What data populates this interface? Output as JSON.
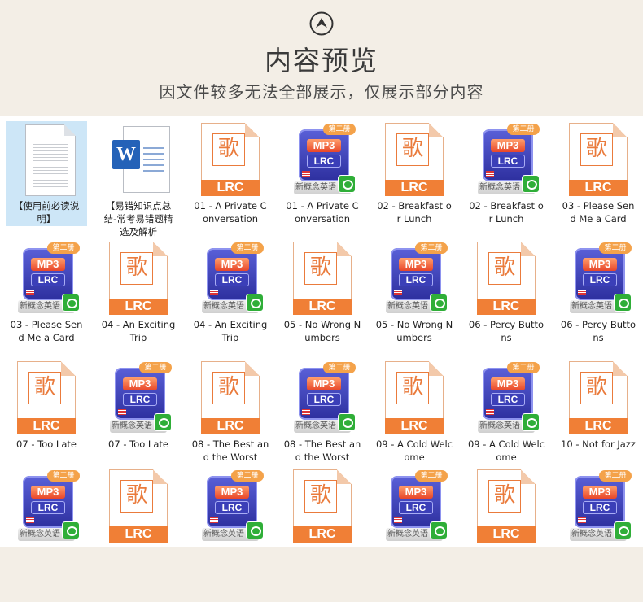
{
  "header": {
    "title": "内容预览",
    "subtitle": "因文件较多无法全部展示，仅展示部分内容"
  },
  "files": [
    {
      "type": "txt",
      "label": "【使用前必读说明】",
      "selected": true
    },
    {
      "type": "doc",
      "label": "【易错知识点总结-常考易错题精选及解析"
    },
    {
      "type": "lrc",
      "label": "01 - A Private Conversation"
    },
    {
      "type": "mp3",
      "label": "01 - A Private Conversation"
    },
    {
      "type": "lrc",
      "label": "02 - Breakfast or Lunch"
    },
    {
      "type": "mp3",
      "label": "02 - Breakfast or Lunch"
    },
    {
      "type": "lrc",
      "label": "03 - Please Send Me a Card"
    },
    {
      "type": "mp3",
      "label": "03 - Please Send Me a Card"
    },
    {
      "type": "lrc",
      "label": "04 - An Exciting Trip"
    },
    {
      "type": "mp3",
      "label": "04 - An Exciting Trip"
    },
    {
      "type": "lrc",
      "label": "05 - No Wrong Numbers"
    },
    {
      "type": "mp3",
      "label": "05 - No Wrong Numbers"
    },
    {
      "type": "lrc",
      "label": "06 - Percy Buttons"
    },
    {
      "type": "mp3",
      "label": "06 - Percy Buttons"
    },
    {
      "type": "lrc",
      "label": "07 - Too Late"
    },
    {
      "type": "mp3",
      "label": "07 - Too Late"
    },
    {
      "type": "lrc",
      "label": "08 - The Best and the Worst"
    },
    {
      "type": "mp3",
      "label": "08 - The Best and the Worst"
    },
    {
      "type": "lrc",
      "label": "09 - A Cold Welcome"
    },
    {
      "type": "mp3",
      "label": "09 - A Cold Welcome"
    },
    {
      "type": "lrc",
      "label": "10 - Not for Jazz"
    },
    {
      "type": "mp3",
      "label": ""
    },
    {
      "type": "lrc",
      "label": ""
    },
    {
      "type": "mp3",
      "label": ""
    },
    {
      "type": "lrc",
      "label": ""
    },
    {
      "type": "mp3",
      "label": ""
    },
    {
      "type": "lrc",
      "label": ""
    },
    {
      "type": "mp3",
      "label": ""
    }
  ],
  "icons": {
    "lrc_glyph": "歌",
    "lrc_text": "LRC",
    "mp3_tag": "第二册",
    "mp3_text": "MP3",
    "mp3_sub": "LRC",
    "mp3_strip": "新概念英语",
    "doc_letter": "W"
  },
  "colors": {
    "accent": "#f07f36",
    "mp3_blue": "#3b3fb8",
    "selection": "#cde6f7"
  }
}
